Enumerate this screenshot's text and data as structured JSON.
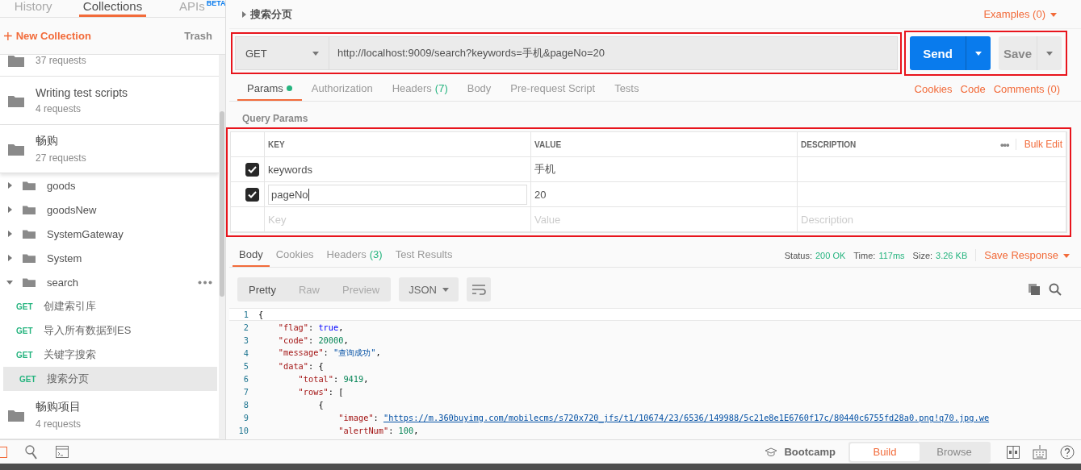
{
  "sidebar": {
    "tabs": [
      {
        "label": "History",
        "selected": false
      },
      {
        "label": "Collections",
        "selected": true
      },
      {
        "label": "APIs",
        "badge": "BETA",
        "selected": false
      }
    ],
    "new_collection": {
      "icon": "+",
      "label": "New Collection"
    },
    "trash": "Trash",
    "collections": [
      {
        "count": "37 requests",
        "expanded": false
      },
      {
        "name": "Writing test scripts",
        "count": "4 requests",
        "expanded": false
      },
      {
        "name": "畅购",
        "count": "27 requests",
        "expanded": true,
        "children": [
          {
            "name": "goods",
            "expanded": false
          },
          {
            "name": "goodsNew",
            "expanded": false
          },
          {
            "name": "SystemGateway",
            "expanded": false
          },
          {
            "name": "System",
            "expanded": false
          },
          {
            "name": "search",
            "expanded": true,
            "show_menu": true,
            "children": [
              {
                "method": "GET",
                "name": "创建索引库",
                "selected": false
              },
              {
                "method": "GET",
                "name": "导入所有数据到ES",
                "selected": false
              },
              {
                "method": "GET",
                "name": "关键字搜索",
                "selected": false
              },
              {
                "method": "GET",
                "name": "搜索分页",
                "selected": true
              }
            ]
          }
        ]
      },
      {
        "name": "畅购项目",
        "count": "4 requests",
        "expanded": false
      }
    ]
  },
  "request": {
    "title": "搜索分页",
    "examples": "Examples (0)",
    "url_bar": {
      "method": "GET",
      "url": "http://localhost:9009/search?keywords=手机&pageNo=20",
      "highlighted": true
    },
    "actions": {
      "send": "Send",
      "save": "Save",
      "highlighted": true
    },
    "tabs": [
      {
        "label": "Params",
        "dot": true,
        "selected": true
      },
      {
        "label": "Authorization",
        "selected": false
      },
      {
        "label": "Headers",
        "count": "(7)",
        "selected": false
      },
      {
        "label": "Body",
        "selected": false
      },
      {
        "label": "Pre-request Script",
        "selected": false
      },
      {
        "label": "Tests",
        "selected": false
      }
    ],
    "links": [
      "Cookies",
      "Code",
      "Comments (0)"
    ],
    "params": {
      "title": "Query Params",
      "highlighted": true,
      "columns": [
        "KEY",
        "VALUE",
        "DESCRIPTION"
      ],
      "more": "•••",
      "bulk_edit": "Bulk Edit",
      "rows": [
        {
          "checked": true,
          "key": "keywords",
          "value": "手机",
          "editing": false
        },
        {
          "checked": true,
          "key": "pageNo",
          "value": "20",
          "editing": true
        }
      ],
      "new_row": [
        {
          "placeholder": "Key"
        },
        {
          "placeholder": "Value"
        },
        {
          "placeholder": "Description"
        }
      ]
    }
  },
  "response": {
    "tabs": [
      {
        "label": "Body",
        "selected": true
      },
      {
        "label": "Cookies",
        "selected": false
      },
      {
        "label": "Headers",
        "count": "(3)",
        "selected": false
      },
      {
        "label": "Test Results",
        "selected": false
      }
    ],
    "status": [
      {
        "label": "Status:",
        "value": "200 OK"
      },
      {
        "label": "Time:",
        "value": "117ms"
      },
      {
        "label": "Size:",
        "value": "3.26 KB"
      }
    ],
    "save_response": "Save Response",
    "views": [
      {
        "label": "Pretty",
        "selected": true
      },
      {
        "label": "Raw",
        "selected": false
      },
      {
        "label": "Preview",
        "selected": false
      }
    ],
    "format": "JSON",
    "code": [
      {
        "number": "1",
        "tokens": [
          {
            "kind": "punct",
            "text": "{"
          }
        ]
      },
      {
        "number": "2",
        "tokens": [
          {
            "kind": "key",
            "text": "    \"flag\""
          },
          {
            "kind": "punct",
            "text": ": "
          },
          {
            "kind": "bool",
            "text": "true"
          },
          {
            "kind": "punct",
            "text": ","
          }
        ]
      },
      {
        "number": "3",
        "tokens": [
          {
            "kind": "key",
            "text": "    \"code\""
          },
          {
            "kind": "punct",
            "text": ": "
          },
          {
            "kind": "number",
            "text": "20000"
          },
          {
            "kind": "punct",
            "text": ","
          }
        ]
      },
      {
        "number": "4",
        "tokens": [
          {
            "kind": "key",
            "text": "    \"message\""
          },
          {
            "kind": "punct",
            "text": ": "
          },
          {
            "kind": "string",
            "text": "\"查询成功\""
          },
          {
            "kind": "punct",
            "text": ","
          }
        ]
      },
      {
        "number": "5",
        "tokens": [
          {
            "kind": "key",
            "text": "    \"data\""
          },
          {
            "kind": "punct",
            "text": ": {"
          }
        ]
      },
      {
        "number": "6",
        "tokens": [
          {
            "kind": "key",
            "text": "        \"total\""
          },
          {
            "kind": "punct",
            "text": ": "
          },
          {
            "kind": "number",
            "text": "9419"
          },
          {
            "kind": "punct",
            "text": ","
          }
        ]
      },
      {
        "number": "7",
        "tokens": [
          {
            "kind": "key",
            "text": "        \"rows\""
          },
          {
            "kind": "punct",
            "text": ": ["
          }
        ]
      },
      {
        "number": "8",
        "tokens": [
          {
            "kind": "punct",
            "text": "            {"
          }
        ]
      },
      {
        "number": "9",
        "tokens": [
          {
            "kind": "key",
            "text": "                \"image\""
          },
          {
            "kind": "punct",
            "text": ": "
          },
          {
            "kind": "link",
            "text": "\"https://m.360buyimg.com/mobilecms/s720x720_jfs/t1/10674/23/6536/149988/5c21e8e1E6760f17c/80440c6755fd28a0.png!q70.jpg.we"
          }
        ]
      },
      {
        "number": "10",
        "tokens": [
          {
            "kind": "key",
            "text": "                \"alertNum\""
          },
          {
            "kind": "punct",
            "text": ": "
          },
          {
            "kind": "number",
            "text": "100"
          },
          {
            "kind": "punct",
            "text": ","
          }
        ]
      }
    ]
  },
  "status_bar": {
    "bootcamp": "Bootcamp",
    "modes": [
      {
        "label": "Build",
        "selected": true
      },
      {
        "label": "Browse",
        "selected": false
      }
    ]
  }
}
